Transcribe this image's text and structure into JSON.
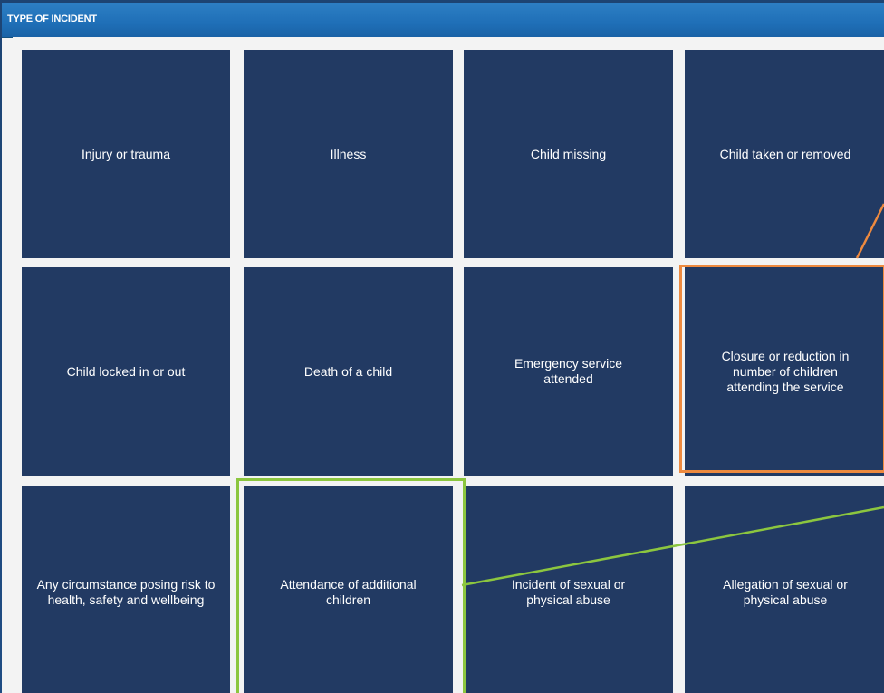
{
  "panel": {
    "title": "TYPE OF INCIDENT"
  },
  "tiles": [
    {
      "label": "Injury or trauma"
    },
    {
      "label": "Illness"
    },
    {
      "label": "Child missing"
    },
    {
      "label": "Child taken or removed"
    },
    {
      "label": "Child locked in or out"
    },
    {
      "label": "Death of a child"
    },
    {
      "label": "Emergency service attended"
    },
    {
      "label": "Closure or reduction in number of children attending the service"
    },
    {
      "label": "Any circumstance posing risk to health, safety and wellbeing"
    },
    {
      "label": "Attendance of additional children"
    },
    {
      "label": "Incident of sexual or physical abuse"
    },
    {
      "label": "Allegation of sexual or physical abuse"
    }
  ],
  "colors": {
    "background": "#1f4a7e",
    "header": "#1f6fb7",
    "tile": "#223a63",
    "highlight_orange": "#ee8a3f",
    "highlight_green": "#8cc63f"
  }
}
